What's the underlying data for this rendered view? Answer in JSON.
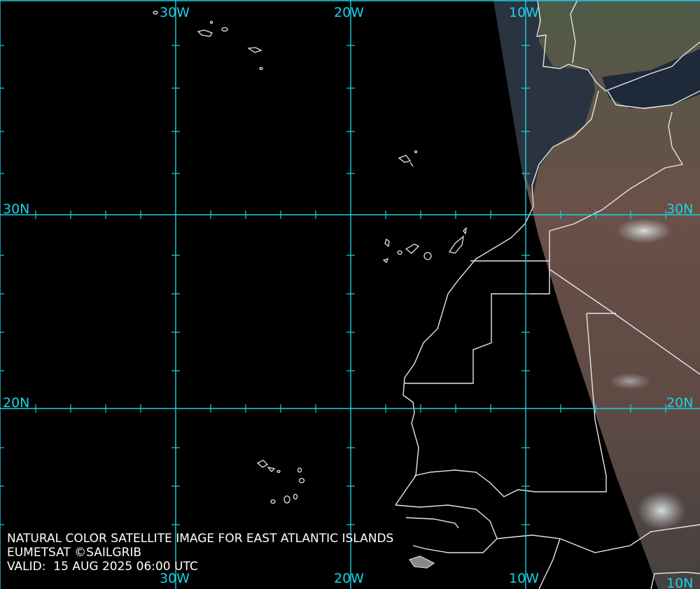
{
  "caption": {
    "line1": "NATURAL COLOR SATELLITE IMAGE FOR EAST ATLANTIC ISLANDS",
    "line2": "EUMETSAT ©SAILGRIB",
    "line3": "VALID:  15 AUG 2025 06:00 UTC"
  },
  "grid": {
    "lon_labels": [
      "30W",
      "20W",
      "10W"
    ],
    "lat_labels": [
      "30N",
      "20N",
      "10N"
    ],
    "color": "#19d3e6"
  },
  "colors": {
    "ocean": "#000000",
    "coastline": "#e6e6e6",
    "land_satellite": "#5a4a44",
    "sea_satellite": "#1e2a3a"
  }
}
